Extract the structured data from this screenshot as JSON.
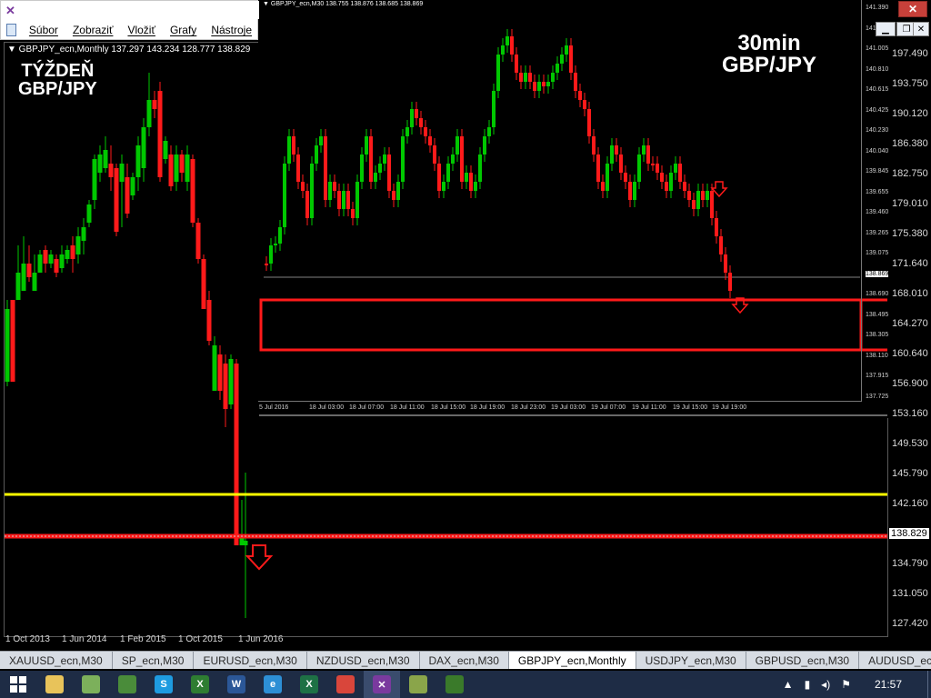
{
  "app": {
    "logo_glyph": "✕",
    "menu": [
      "Súbor",
      "Zobraziť",
      "Vložiť",
      "Grafy",
      "Nástroje"
    ]
  },
  "main_chart": {
    "header": "▼ GBPJPY_ecn,Monthly  137.297 143.234 128.777 138.829",
    "label_left": [
      "TÝŽDEŇ",
      "GBP/JPY"
    ],
    "label_right": [
      "30min",
      "GBP/JPY"
    ],
    "current_price": "138.829",
    "price_axis": [
      "197.490",
      "193.750",
      "190.120",
      "186.380",
      "182.750",
      "179.010",
      "175.380",
      "171.640",
      "168.010",
      "164.270",
      "160.640",
      "156.900",
      "153.160",
      "149.530",
      "145.790",
      "142.160",
      "138.829",
      "134.790",
      "131.050",
      "127.420"
    ],
    "time_axis": [
      "1 Oct 2013",
      "1 Jun 2014",
      "1 Feb 2015",
      "1 Oct 2015",
      "1 Jun 2016"
    ],
    "colors": {
      "bull": "#00c800",
      "bear": "#ff1a1a",
      "resistance": "#ffff00",
      "support": "#ff1a1a"
    }
  },
  "inset_chart": {
    "header": "▼ GBPJPY_ecn,M30  138.755 138.876 138.685 138.869",
    "price_axis": [
      "141.390",
      "141.195",
      "141.005",
      "140.810",
      "140.615",
      "140.425",
      "140.230",
      "140.040",
      "139.845",
      "139.655",
      "139.460",
      "139.265",
      "139.075",
      "138.869",
      "138.690",
      "138.495",
      "138.305",
      "138.110",
      "137.915",
      "137.725"
    ],
    "time_axis": [
      "5 Jul 2016",
      "18 Jul 03:00",
      "18 Jul 07:00",
      "18 Jul 11:00",
      "18 Jul 15:00",
      "18 Jul 19:00",
      "18 Jul 23:00",
      "19 Jul 03:00",
      "19 Jul 07:00",
      "19 Jul 11:00",
      "19 Jul 15:00",
      "19 Jul 19:00"
    ]
  },
  "window_controls": {
    "close_top": "✕",
    "minimize": "▁",
    "restore": "❐",
    "close": "✕"
  },
  "tabs": [
    {
      "label": "XAUUSD_ecn,M30",
      "active": false
    },
    {
      "label": "SP_ecn,M30",
      "active": false
    },
    {
      "label": "EURUSD_ecn,M30",
      "active": false
    },
    {
      "label": "NZDUSD_ecn,M30",
      "active": false
    },
    {
      "label": "DAX_ecn,M30",
      "active": false
    },
    {
      "label": "GBPJPY_ecn,Monthly",
      "active": true
    },
    {
      "label": "USDJPY_ecn,M30",
      "active": false
    },
    {
      "label": "GBPUSD_ecn,M30",
      "active": false
    },
    {
      "label": "AUDUSD_ecn,",
      "active": false
    }
  ],
  "taskbar": {
    "apps": [
      {
        "name": "file-explorer-icon",
        "glyph": "",
        "color": "#e8c35a"
      },
      {
        "name": "image-viewer-icon",
        "glyph": "",
        "color": "#7cb05b"
      },
      {
        "name": "media-icon",
        "glyph": "",
        "color": "#4a8c3a"
      },
      {
        "name": "skype-icon",
        "glyph": "S",
        "color": "#1e9be0"
      },
      {
        "name": "excel-icon",
        "glyph": "X",
        "color": "#2e7d32"
      },
      {
        "name": "word-icon",
        "glyph": "W",
        "color": "#2b5797"
      },
      {
        "name": "explorer-icon",
        "glyph": "e",
        "color": "#2d8fd5"
      },
      {
        "name": "excel-icon-2",
        "glyph": "X",
        "color": "#1e7145"
      },
      {
        "name": "chrome-icon",
        "glyph": "",
        "color": "#d9463b"
      },
      {
        "name": "metatrader-icon",
        "glyph": "✕",
        "color": "#7a3a9e"
      },
      {
        "name": "photo-icon",
        "glyph": "",
        "color": "#8aa54a"
      },
      {
        "name": "chart-app-icon",
        "glyph": "",
        "color": "#3a7a2a"
      }
    ],
    "time": "21:57"
  }
}
